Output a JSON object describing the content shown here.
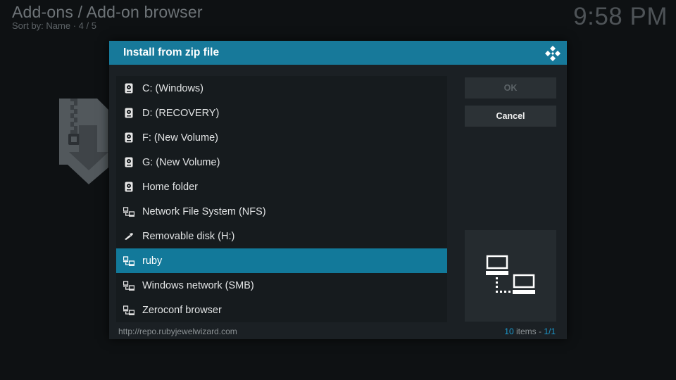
{
  "background": {
    "title": "Add-ons / Add-on browser",
    "subtitle": "Sort by: Name  · 4 / 5",
    "clock": "9:58 PM"
  },
  "dialog": {
    "title": "Install from zip file",
    "logo_icon": "kodi-logo-icon",
    "items": [
      {
        "label": "C: (Windows)",
        "icon": "hard-drive-icon"
      },
      {
        "label": "D: (RECOVERY)",
        "icon": "hard-drive-icon"
      },
      {
        "label": "F: (New Volume)",
        "icon": "hard-drive-icon"
      },
      {
        "label": "G: (New Volume)",
        "icon": "hard-drive-icon"
      },
      {
        "label": "Home folder",
        "icon": "hard-drive-icon"
      },
      {
        "label": "Network File System (NFS)",
        "icon": "network-icon"
      },
      {
        "label": "Removable disk (H:)",
        "icon": "usb-icon"
      },
      {
        "label": "ruby",
        "icon": "network-icon",
        "selected": true
      },
      {
        "label": "Windows network (SMB)",
        "icon": "network-icon"
      },
      {
        "label": "Zeroconf browser",
        "icon": "network-icon"
      }
    ],
    "ok_label": "OK",
    "cancel_label": "Cancel",
    "preview_icon": "network-computers-icon",
    "footer_path": "http://repo.rubyjewelwizard.com",
    "footer_count": "10",
    "footer_items_word": " items - ",
    "footer_page": "1/1",
    "colors": {
      "header": "#17799a",
      "selected": "#12799a",
      "accent_text": "#1d9bd0"
    }
  }
}
